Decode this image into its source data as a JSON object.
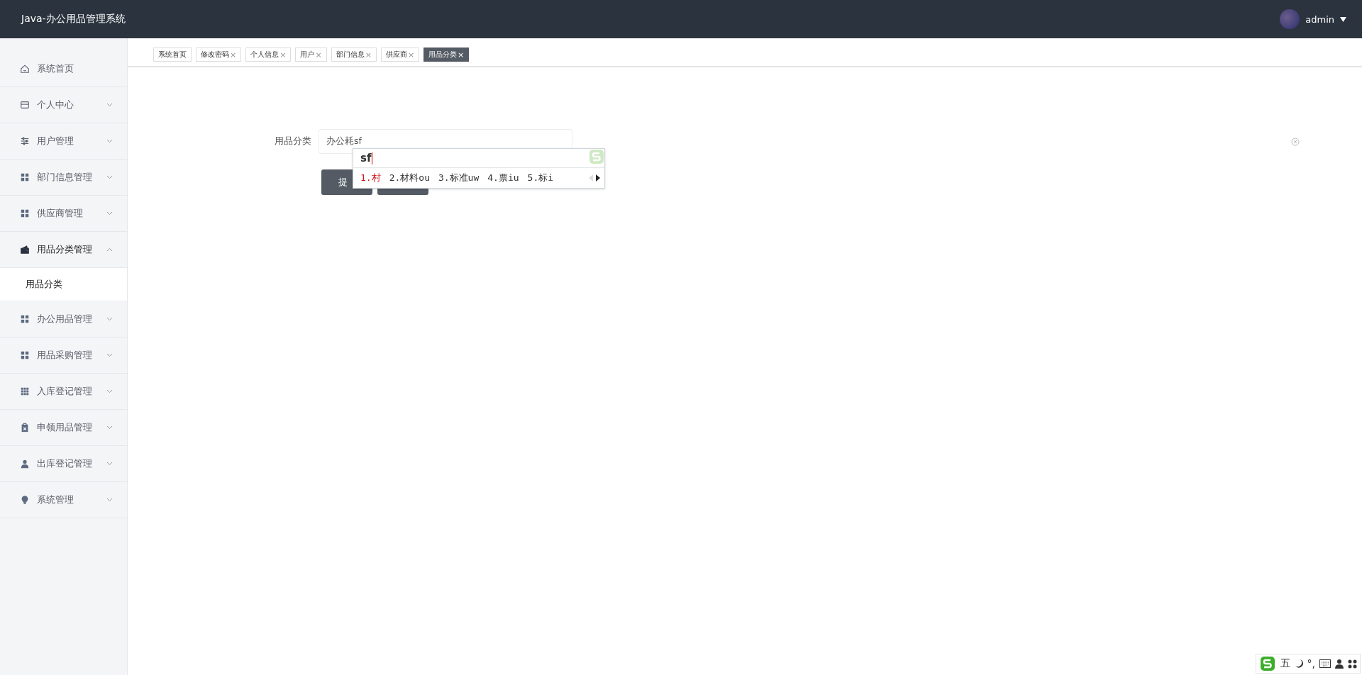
{
  "header": {
    "title": "Java-办公用品管理系统",
    "user": "admin"
  },
  "tabs": [
    {
      "label": "系统首页",
      "selected": false
    },
    {
      "label": "修改密码",
      "close": "×",
      "selected": false
    },
    {
      "label": "个人信息",
      "close": "×",
      "selected": false
    },
    {
      "label": "用户",
      "close": "×",
      "selected": false
    },
    {
      "label": "部门信息",
      "close": "×",
      "selected": false
    },
    {
      "label": "供应商",
      "close": "×",
      "selected": false
    },
    {
      "label": "用品分类",
      "close": "×",
      "selected": true
    }
  ],
  "sidebar": {
    "items": [
      {
        "label": "系统首页"
      },
      {
        "label": "个人中心",
        "expanded": false
      },
      {
        "label": "用户管理",
        "expanded": false
      },
      {
        "label": "部门信息管理",
        "expanded": false
      },
      {
        "label": "供应商管理",
        "expanded": false
      },
      {
        "label": "用品分类管理",
        "expanded": true,
        "children": [
          {
            "label": "用品分类",
            "selected": true
          }
        ]
      },
      {
        "label": "办公用品管理",
        "expanded": false
      },
      {
        "label": "用品采购管理",
        "expanded": false
      },
      {
        "label": "入库登记管理",
        "expanded": false
      },
      {
        "label": "申领用品管理",
        "expanded": false
      },
      {
        "label": "出库登记管理",
        "expanded": false
      },
      {
        "label": "系统管理",
        "expanded": false
      }
    ]
  },
  "form": {
    "label": "用品分类",
    "value": "办公耗sf",
    "submit_label": "提"
  },
  "ime": {
    "composition": "sf",
    "candidates": [
      {
        "text": "1.村",
        "selected": true
      },
      {
        "text": "2.材料ou",
        "selected": false
      },
      {
        "text": "3.标准uw",
        "selected": false
      },
      {
        "text": "4.票iu",
        "selected": false
      },
      {
        "text": "5.标i",
        "selected": false
      }
    ]
  },
  "ime_bar": {
    "mode": "五",
    "punct": "°,"
  }
}
